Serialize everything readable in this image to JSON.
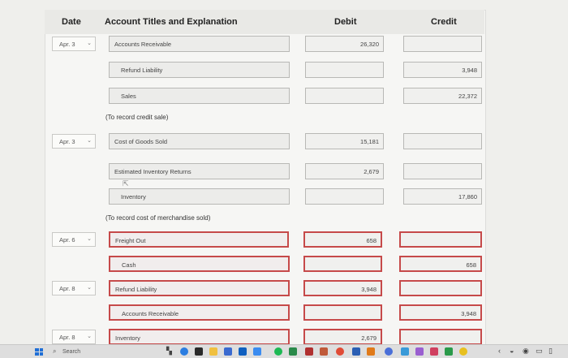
{
  "header": {
    "date": "Date",
    "account": "Account Titles and Explanation",
    "debit": "Debit",
    "credit": "Credit"
  },
  "rows": [
    {
      "date": "Apr. 3",
      "account": "Accounts Receivable",
      "debit": "26,320",
      "credit": ""
    },
    {
      "date": "",
      "account": "Refund Liability",
      "debit": "",
      "credit": "3,948"
    },
    {
      "date": "",
      "account": "Sales",
      "debit": "",
      "credit": "22,372"
    },
    {
      "date": "Apr. 3",
      "account": "Cost of Goods Sold",
      "debit": "15,181",
      "credit": ""
    },
    {
      "date": "",
      "account": "Estimated Inventory Returns",
      "debit": "2,679",
      "credit": ""
    },
    {
      "date": "",
      "account": "Inventory",
      "debit": "",
      "credit": "17,860"
    },
    {
      "date": "Apr. 6",
      "account": "Freight Out",
      "debit": "658",
      "credit": ""
    },
    {
      "date": "",
      "account": "Cash",
      "debit": "",
      "credit": "658"
    },
    {
      "date": "Apr. 8",
      "account": "Refund Liability",
      "debit": "3,948",
      "credit": ""
    },
    {
      "date": "",
      "account": "Accounts Receivable",
      "debit": "",
      "credit": "3,948"
    },
    {
      "date": "Apr. 8",
      "account": "Inventory",
      "debit": "2,679",
      "credit": ""
    }
  ],
  "notes": {
    "sale": "(To record credit sale)",
    "cost": "(To record cost of merchandise sold)"
  },
  "taskbar": {
    "search_label": "Search"
  },
  "colors": {
    "error_border": "#c64a4a",
    "windows_blue": "#1f6fd6"
  }
}
